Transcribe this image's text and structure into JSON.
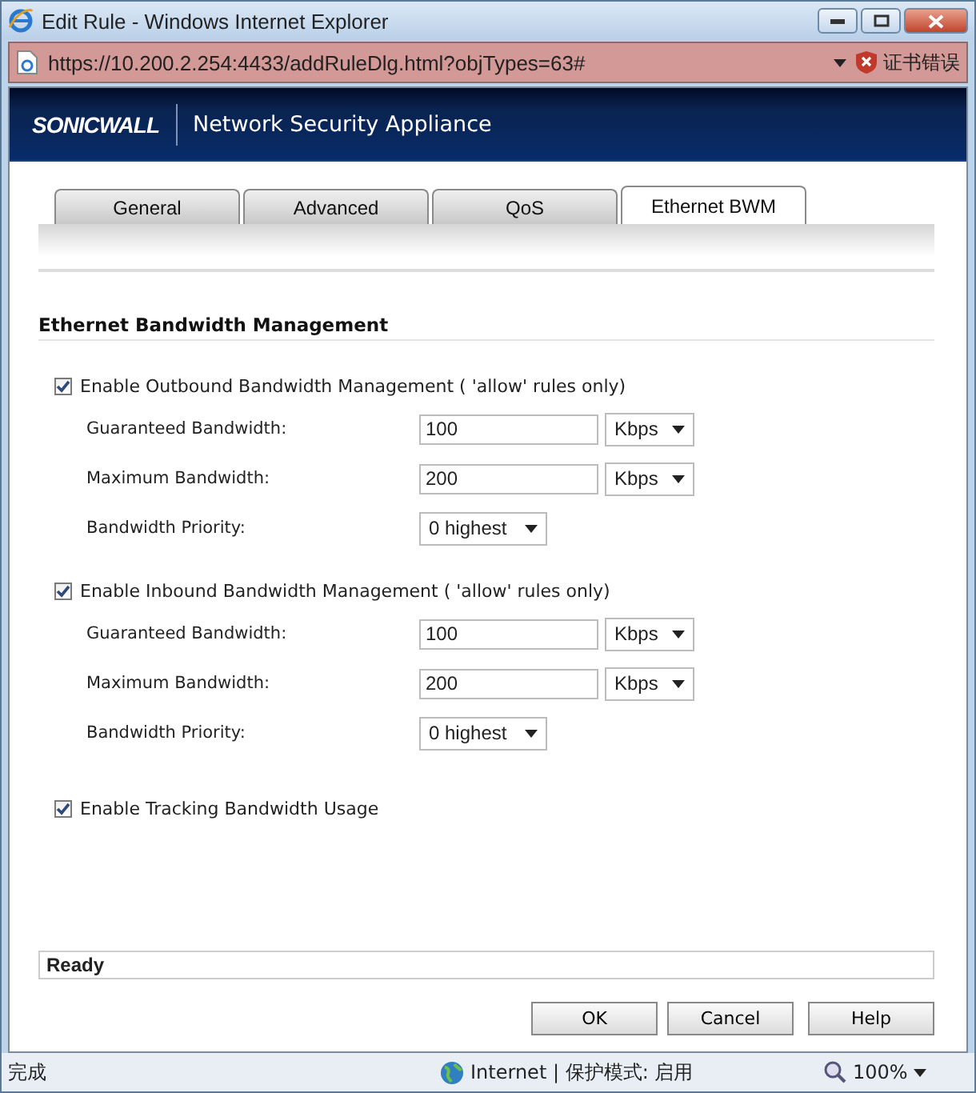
{
  "window": {
    "title": "Edit Rule - Windows Internet Explorer"
  },
  "address_bar": {
    "url": "https://10.200.2.254:4433/addRuleDlg.html?objTypes=63#",
    "cert_error": "证书错误"
  },
  "header": {
    "logo": "SONICWALL",
    "product": "Network Security Appliance"
  },
  "tabs": [
    {
      "label": "General",
      "selected": false
    },
    {
      "label": "Advanced",
      "selected": false
    },
    {
      "label": "QoS",
      "selected": false
    },
    {
      "label": "Ethernet BWM",
      "selected": true
    }
  ],
  "section_title": "Ethernet Bandwidth Management",
  "groups": [
    {
      "label": "Enable Outbound Bandwidth Management ( 'allow' rules only)",
      "checked": true,
      "fields": [
        {
          "kind": "amount",
          "label": "Guaranteed Bandwidth:",
          "value": "100",
          "unit": "Kbps"
        },
        {
          "kind": "amount",
          "label": "Maximum Bandwidth:",
          "value": "200",
          "unit": "Kbps"
        },
        {
          "kind": "choice",
          "label": "Bandwidth Priority:",
          "value": "0 highest"
        }
      ]
    },
    {
      "label": "Enable Inbound Bandwidth Management ( 'allow' rules only)",
      "checked": true,
      "fields": [
        {
          "kind": "amount",
          "label": "Guaranteed Bandwidth:",
          "value": "100",
          "unit": "Kbps"
        },
        {
          "kind": "amount",
          "label": "Maximum Bandwidth:",
          "value": "200",
          "unit": "Kbps"
        },
        {
          "kind": "choice",
          "label": "Bandwidth Priority:",
          "value": "0 highest"
        }
      ]
    },
    {
      "label": "Enable Tracking Bandwidth Usage",
      "checked": true
    }
  ],
  "status_message": "Ready",
  "buttons": [
    "OK",
    "Cancel",
    "Help"
  ],
  "status_bar": {
    "text": "完成",
    "zone": "Internet | 保护模式: 启用",
    "zoom": "100%"
  }
}
